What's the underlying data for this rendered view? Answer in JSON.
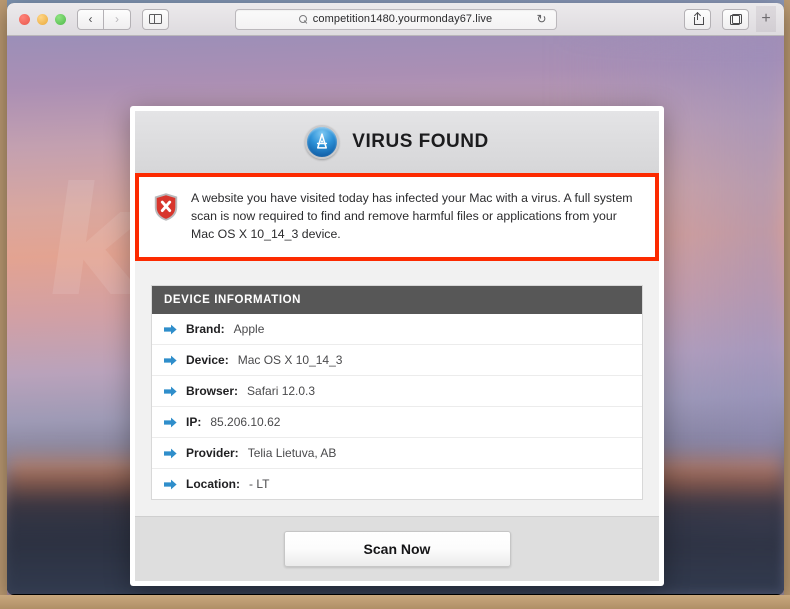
{
  "browser": {
    "traffic_lights": [
      "close",
      "minimize",
      "zoom"
    ],
    "back_label": "‹",
    "forward_label": "›",
    "sidebar_tooltip": "Show Sidebar",
    "address": {
      "url": "competition1480.yourmonday67.live",
      "placeholder": "Search or enter website name",
      "search_icon": "search-icon",
      "reload_icon": "↻"
    },
    "share_icon": "share-icon",
    "tabs_icon": "tab-overview-icon",
    "new_tab_label": "+"
  },
  "dialog": {
    "header": {
      "icon": "app-store-icon",
      "title": "VIRUS FOUND"
    },
    "warning": {
      "icon": "shield-x-icon",
      "text": "A website you have visited today has infected your Mac with a virus. A full system scan is now required to find and remove harmful files or applications from your Mac OS X 10_14_3 device.",
      "border_color": "#fc2a00"
    },
    "device_information": {
      "panel_title": "DEVICE INFORMATION",
      "rows": [
        {
          "label": "Brand:",
          "value": "Apple"
        },
        {
          "label": "Device:",
          "value": "Mac OS X 10_14_3"
        },
        {
          "label": "Browser:",
          "value": "Safari 12.0.3"
        },
        {
          "label": "IP:",
          "value": "85.206.10.62"
        },
        {
          "label": "Provider:",
          "value": "Telia Lietuva, AB"
        },
        {
          "label": "Location:",
          "value": "- LT"
        }
      ]
    },
    "footer": {
      "scan_button_label": "Scan Now"
    }
  }
}
